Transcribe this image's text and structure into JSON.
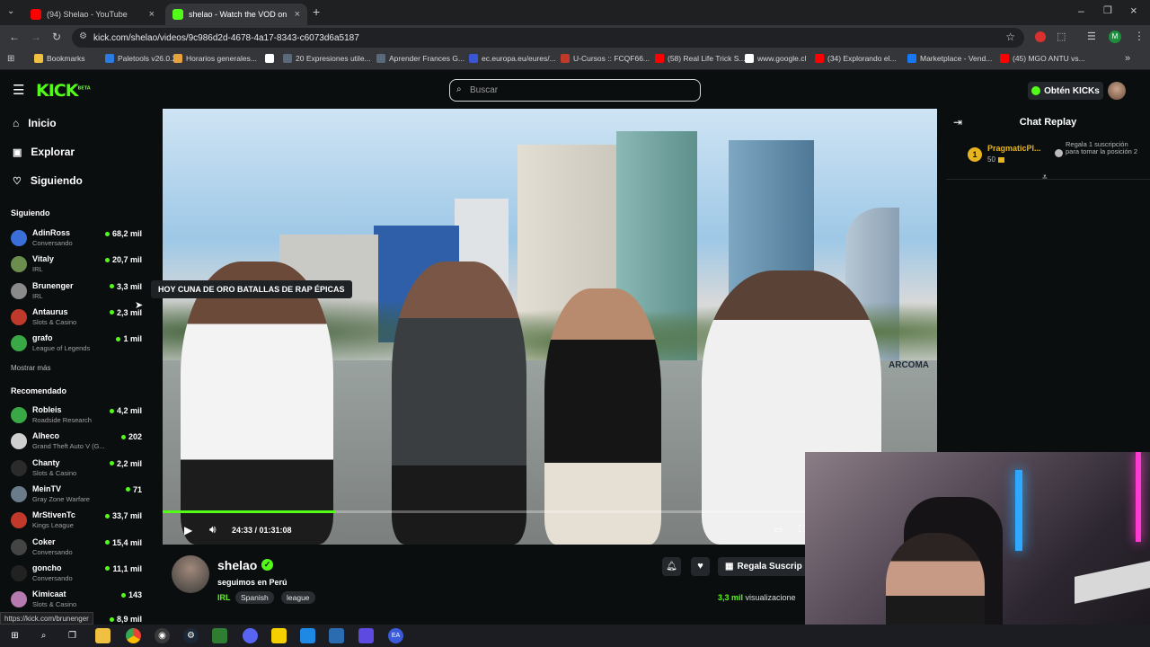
{
  "browser": {
    "tabs": [
      {
        "label": "(94) Shelao - YouTube",
        "color": "#ff0000"
      },
      {
        "label": "shelao - Watch the VOD on Kick",
        "color": "#53fc18"
      }
    ],
    "url": "kick.com/shelao/videos/9c986d2d-4678-4a17-8343-c6073d6a5187",
    "bookmarks": [
      {
        "label": "Bookmarks",
        "color": "#f0c040"
      },
      {
        "label": "Paletools v26.0.28",
        "color": "#2a7be4"
      },
      {
        "label": "Horarios generales...",
        "color": "#e6a23c"
      },
      {
        "label": "",
        "color": "#ffffff"
      },
      {
        "label": "20 Expresiones utile...",
        "color": "#5b6a7a"
      },
      {
        "label": "Aprender Frances G...",
        "color": "#5b6a7a"
      },
      {
        "label": "ec.europa.eu/eures/...",
        "color": "#3a56d4"
      },
      {
        "label": "U-Cursos :: FCQF66...",
        "color": "#c0392b"
      },
      {
        "label": "(58) Real Life Trick S...",
        "color": "#ff0000"
      },
      {
        "label": "www.google.cl",
        "color": "#ffffff"
      },
      {
        "label": "(34) Explorando el...",
        "color": "#ff0000"
      },
      {
        "label": "Marketplace - Vend...",
        "color": "#1877f2"
      },
      {
        "label": "(45) MGO ANTU vs...",
        "color": "#ff0000"
      }
    ],
    "status_url": "https://kick.com/brunenger"
  },
  "header": {
    "logo": "KICK",
    "logo_sup": "BETA",
    "search_placeholder": "Buscar",
    "obtener_label": "Obtén KICKs"
  },
  "sidebar": {
    "nav": [
      {
        "label": "Inicio",
        "icon": "home-icon"
      },
      {
        "label": "Explorar",
        "icon": "explore-icon"
      },
      {
        "label": "Siguiendo",
        "icon": "heart-icon"
      }
    ],
    "following_title": "Siguiendo",
    "following": [
      {
        "name": "AdinRoss",
        "category": "Conversando",
        "viewers": "68,2 mil",
        "color": "#3b6fd8"
      },
      {
        "name": "Vitaly",
        "category": "IRL",
        "viewers": "20,7 mil",
        "color": "#6b8e4e"
      },
      {
        "name": "Brunenger",
        "category": "IRL",
        "viewers": "3,3 mil",
        "color": "#8a8a8a"
      },
      {
        "name": "Antaurus",
        "category": "Slots & Casino",
        "viewers": "2,3 mil",
        "color": "#c03a2b"
      },
      {
        "name": "grafo",
        "category": "League of Legends",
        "viewers": "1 mil",
        "color": "#3aa845"
      }
    ],
    "show_more": "Mostrar más",
    "recommended_title": "Recomendado",
    "recommended": [
      {
        "name": "Robleis",
        "category": "Roadside Research",
        "viewers": "4,2 mil",
        "color": "#3aa845"
      },
      {
        "name": "Alheco",
        "category": "Grand Theft Auto V (G...",
        "viewers": "202",
        "color": "#cfcfcf"
      },
      {
        "name": "Chanty",
        "category": "Slots & Casino",
        "viewers": "2,2 mil",
        "color": "#2b2b2b"
      },
      {
        "name": "MeinTV",
        "category": "Gray Zone Warfare",
        "viewers": "71",
        "color": "#6a7c8a"
      },
      {
        "name": "MrStivenTc",
        "category": "Kings League",
        "viewers": "33,7 mil",
        "color": "#c0392b"
      },
      {
        "name": "Coker",
        "category": "Conversando",
        "viewers": "15,4 mil",
        "color": "#444"
      },
      {
        "name": "goncho",
        "category": "Conversando",
        "viewers": "11,1 mil",
        "color": "#222"
      },
      {
        "name": "Kimicaat",
        "category": "Slots & Casino",
        "viewers": "143",
        "color": "#b57ab0"
      }
    ],
    "partial_viewers": "8,9 mil"
  },
  "video": {
    "tooltip": "HOY CUNA DE ORO BATALLAS DE RAP ÉPICAS",
    "time": "24:33 / 01:31:08",
    "progress": 0.27,
    "watermark": "ARCOMA"
  },
  "chat": {
    "title": "Chat Replay",
    "pinned_rank": "1",
    "pinned_user": "PragmaticPl...",
    "pinned_amount": "50",
    "pinned_text": "Regala 1 suscripción para tomar la posición 2"
  },
  "channel": {
    "name": "shelao",
    "title": "seguimos en Perú",
    "tags": [
      "Spanish",
      "league"
    ],
    "category": "IRL",
    "subscribe_label": "Regala Suscrip",
    "viewers": "3,3 mil",
    "viewers_label": "visualizacione"
  },
  "colors": {
    "accent": "#53fc18",
    "bg": "#0b0e0f"
  }
}
